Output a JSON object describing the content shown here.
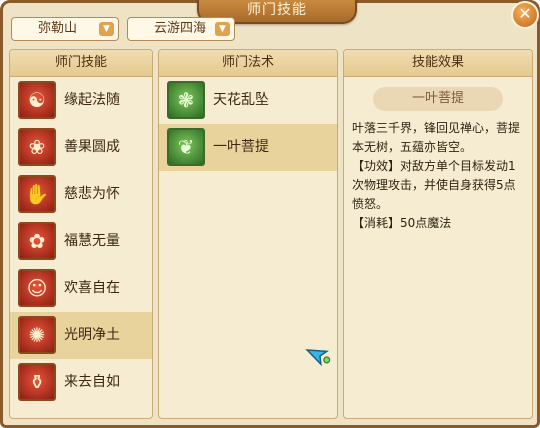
{
  "window": {
    "title": "师门技能",
    "close_icon": "✕"
  },
  "filters": {
    "sect": "弥勒山",
    "region": "云游四海",
    "dropdown_icon": "▼"
  },
  "skills_panel": {
    "header": "师门技能",
    "items": [
      {
        "label": "缘起法随",
        "icon": "☯"
      },
      {
        "label": "善果圆成",
        "icon": "❀"
      },
      {
        "label": "慈悲为怀",
        "icon": "✋"
      },
      {
        "label": "福慧无量",
        "icon": "✿"
      },
      {
        "label": "欢喜自在",
        "icon": "☺"
      },
      {
        "label": "光明净土",
        "icon": "✺"
      },
      {
        "label": "来去自如",
        "icon": "⚱"
      }
    ],
    "selected_index": 5
  },
  "spells_panel": {
    "header": "师门法术",
    "items": [
      {
        "label": "天花乱坠",
        "icon": "❃"
      },
      {
        "label": "一叶菩提",
        "icon": "❦"
      }
    ],
    "selected_index": 1
  },
  "effect_panel": {
    "header": "技能效果",
    "spell_name": "一叶菩提",
    "description": "叶落三千界，锋回见禅心，菩提本无树，五蕴亦皆空。",
    "effect": "【功效】对敌方单个目标发动1次物理攻击，并使自身获得5点愤怒。",
    "cost": "【消耗】50点魔法"
  }
}
